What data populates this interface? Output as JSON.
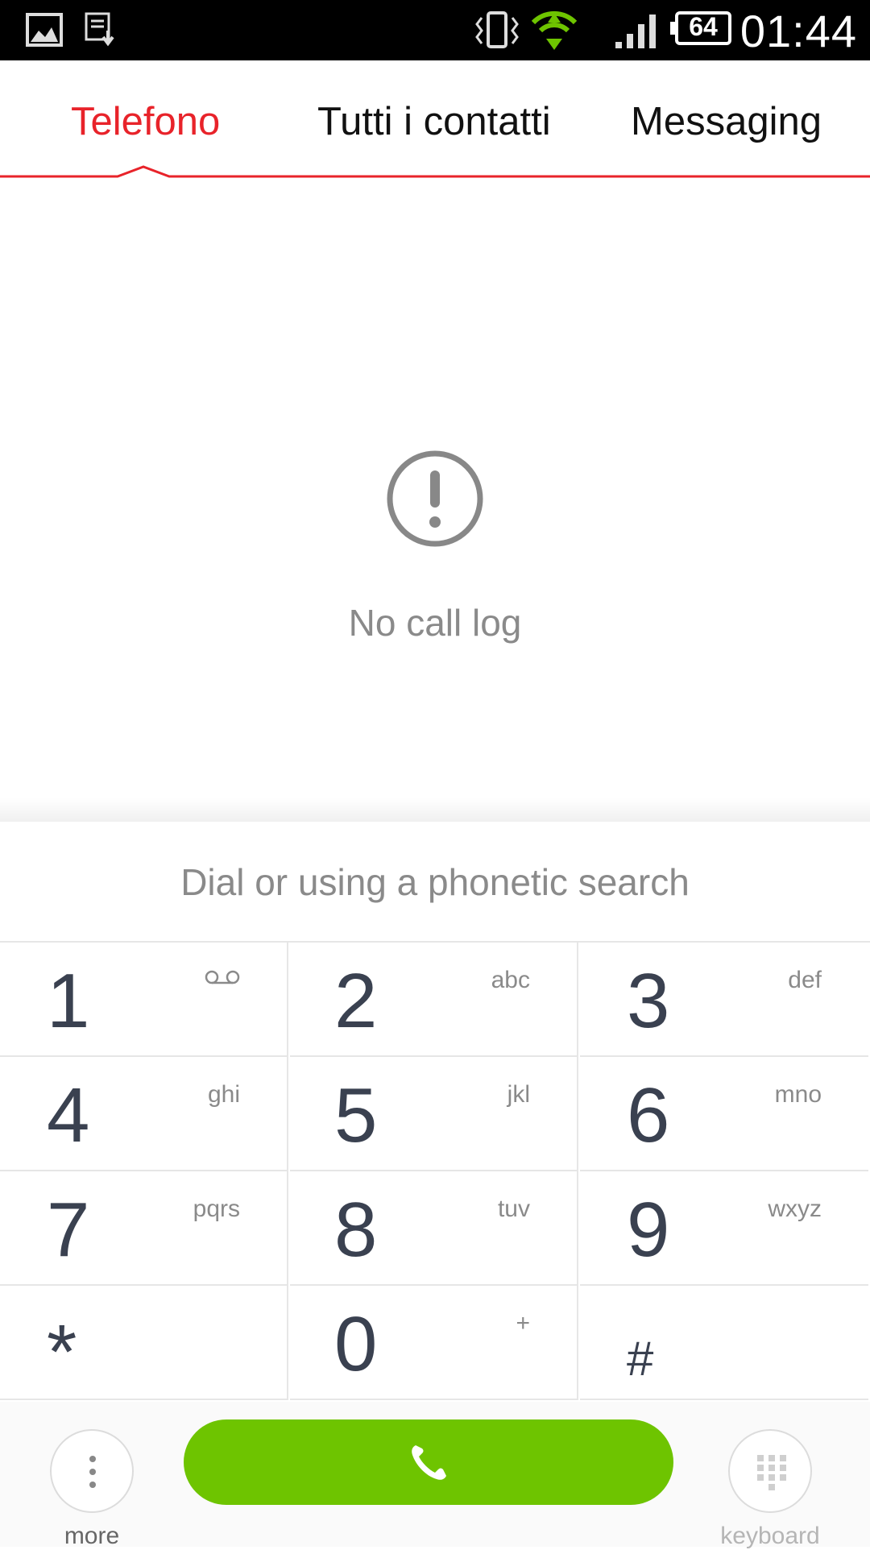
{
  "status_bar": {
    "time": "01:44",
    "battery": "64",
    "icons": [
      "gallery-notification-icon",
      "download-notification-icon",
      "vibrate-icon",
      "wifi-icon",
      "signal-icon",
      "battery-icon"
    ]
  },
  "tabs": [
    {
      "label": "Telefono",
      "active": true
    },
    {
      "label": "Tutti i contatti",
      "active": false
    },
    {
      "label": "Messaging",
      "active": false
    }
  ],
  "empty_state": {
    "icon": "alert-circle-icon",
    "text": "No call log"
  },
  "dial": {
    "placeholder": "Dial or using a phonetic search"
  },
  "keys": [
    {
      "digit": "1",
      "letters": ""
    },
    {
      "digit": "2",
      "letters": "abc"
    },
    {
      "digit": "3",
      "letters": "def"
    },
    {
      "digit": "4",
      "letters": "ghi"
    },
    {
      "digit": "5",
      "letters": "jkl"
    },
    {
      "digit": "6",
      "letters": "mno"
    },
    {
      "digit": "7",
      "letters": "pqrs"
    },
    {
      "digit": "8",
      "letters": "tuv"
    },
    {
      "digit": "9",
      "letters": "wxyz"
    },
    {
      "digit": "*",
      "letters": ""
    },
    {
      "digit": "0",
      "letters": "+"
    },
    {
      "digit": "#",
      "letters": ""
    }
  ],
  "bottom": {
    "more_label": "more",
    "keyboard_label": "keyboard",
    "call_icon": "phone-icon"
  },
  "colors": {
    "accent": "#e8232a",
    "call_green": "#6ec400",
    "digit": "#3a4150"
  }
}
